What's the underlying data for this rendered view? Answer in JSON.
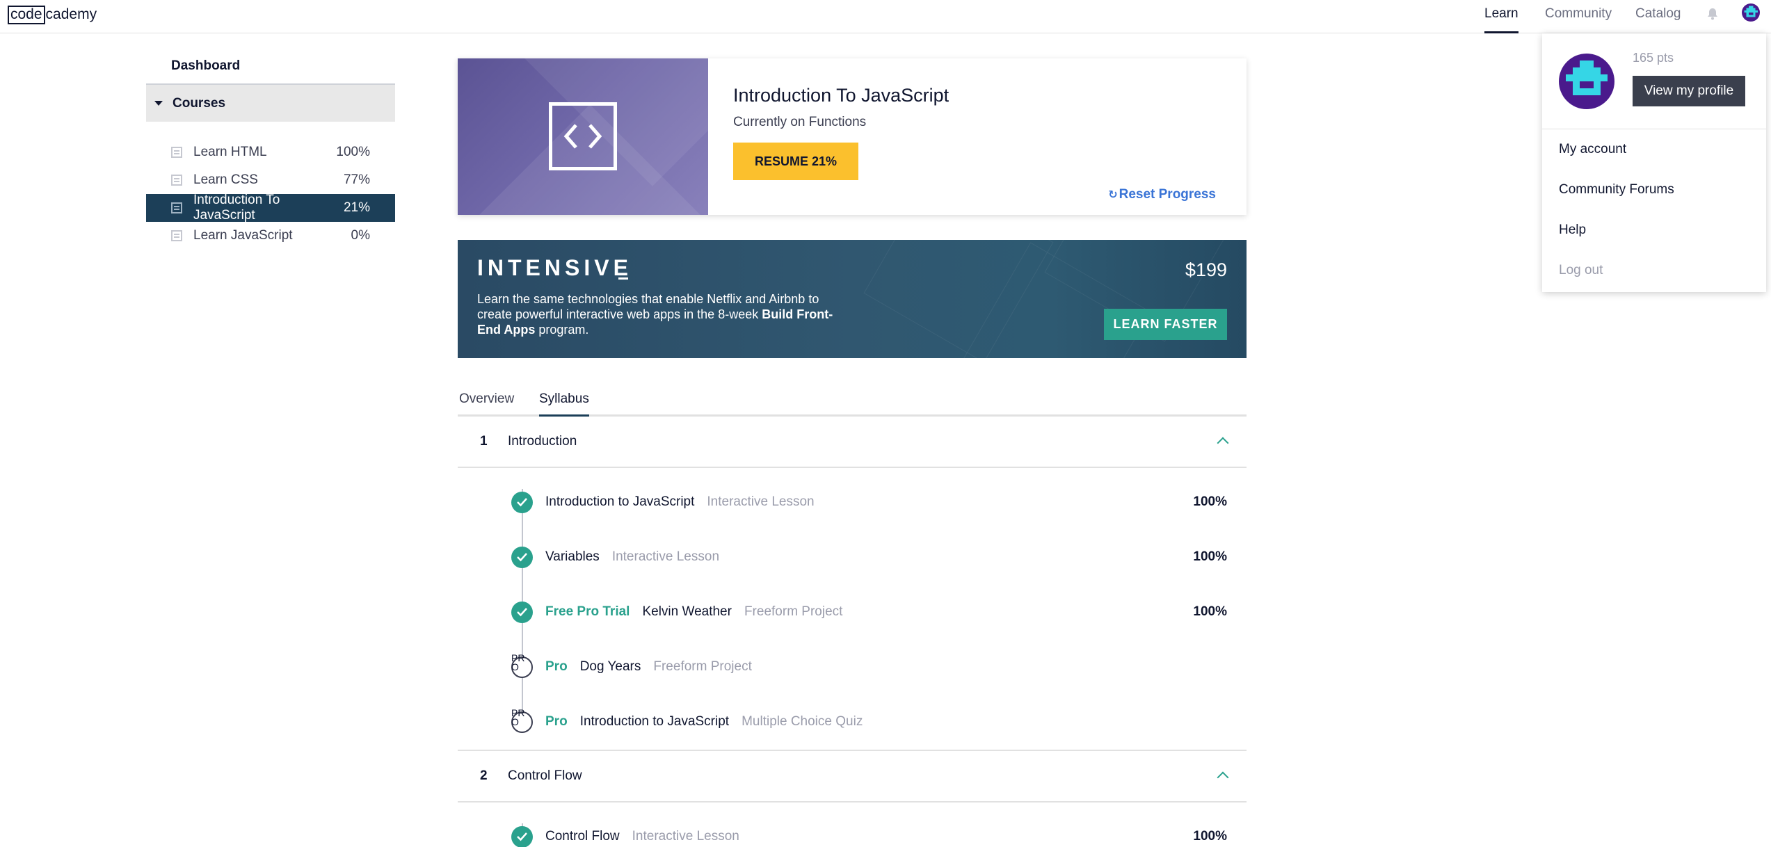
{
  "brand": {
    "logo_boxed": "code",
    "logo_rest": "cademy"
  },
  "nav": {
    "links": [
      "Learn",
      "Community",
      "Catalog"
    ],
    "active": "Learn"
  },
  "sidebar": {
    "dashboard": "Dashboard",
    "courses_heading": "Courses",
    "courses": [
      {
        "name": "Learn HTML",
        "progress": "100%",
        "active": false
      },
      {
        "name": "Learn CSS",
        "progress": "77%",
        "active": false
      },
      {
        "name": "Introduction To JavaScript",
        "progress": "21%",
        "active": true
      },
      {
        "name": "Learn JavaScript",
        "progress": "0%",
        "active": false
      }
    ]
  },
  "course_card": {
    "title": "Introduction To JavaScript",
    "subtitle": "Currently on Functions",
    "resume_label": "RESUME 21%",
    "reset_label": "Reset Progress",
    "reset_icon": "refresh-icon",
    "art_icon": "code-brackets-icon"
  },
  "intensive": {
    "title": "INTENSIVE",
    "text_prefix": "Learn the same technologies that enable Netflix and Airbnb to create powerful interactive web apps in the 8-week ",
    "text_bold": "Build Front-End Apps",
    "text_suffix": " program.",
    "price": "$199",
    "button": "LEARN FASTER"
  },
  "tabs": {
    "items": [
      "Overview",
      "Syllabus"
    ],
    "active": "Syllabus"
  },
  "syllabus": {
    "sections": [
      {
        "number": "1",
        "title": "Introduction",
        "lessons": [
          {
            "tag": "",
            "name": "Introduction to JavaScript",
            "type": "Interactive Lesson",
            "progress": "100%",
            "status": "done"
          },
          {
            "tag": "",
            "name": "Variables",
            "type": "Interactive Lesson",
            "progress": "100%",
            "status": "done"
          },
          {
            "tag": "Free Pro Trial",
            "name": "Kelvin Weather",
            "type": "Freeform Project",
            "progress": "100%",
            "status": "done"
          },
          {
            "tag": "Pro",
            "name": "Dog Years",
            "type": "Freeform Project",
            "progress": "",
            "status": "pro"
          },
          {
            "tag": "Pro",
            "name": "Introduction to JavaScript",
            "type": "Multiple Choice Quiz",
            "progress": "",
            "status": "pro"
          }
        ]
      },
      {
        "number": "2",
        "title": "Control Flow",
        "lessons": [
          {
            "tag": "",
            "name": "Control Flow",
            "type": "Interactive Lesson",
            "progress": "100%",
            "status": "done"
          }
        ]
      }
    ],
    "pro_badge_text": "PRO"
  },
  "profile_menu": {
    "points": "165 pts",
    "view_profile": "View my profile",
    "items": [
      "My account",
      "Community Forums",
      "Help"
    ],
    "logout": "Log out"
  },
  "colors": {
    "navy": "#1c3f58",
    "teal": "#2aa18d",
    "yellow": "#fbc02d",
    "link_blue": "#3a74d6",
    "avatar_bg": "#4a1a8c",
    "avatar_fg": "#35d6e6"
  }
}
